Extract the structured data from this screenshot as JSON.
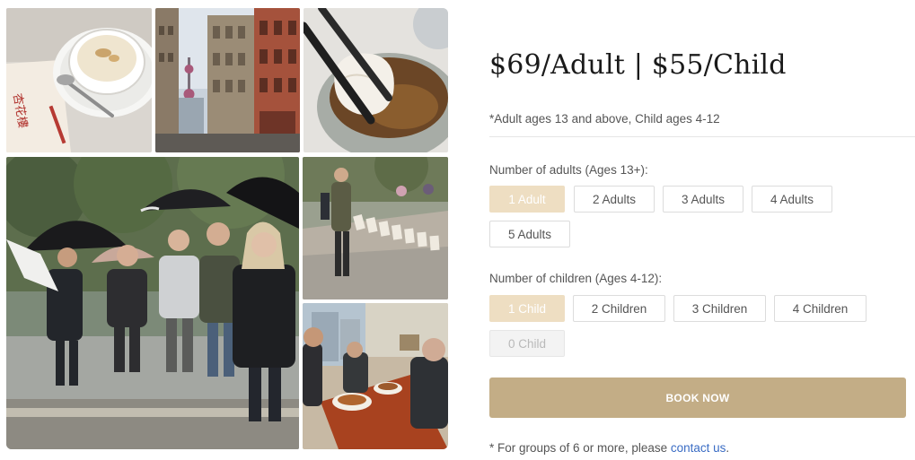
{
  "gallery": {
    "photos": [
      {
        "subject": "congee bowl with dim sum menu"
      },
      {
        "subject": "Bund street with Oriental Pearl Tower"
      },
      {
        "subject": "chopsticks lifting a dumpling"
      },
      {
        "subject": "tour group with umbrellas in garden"
      },
      {
        "subject": "street vendor with book stall"
      },
      {
        "subject": "tour group eating noodles"
      }
    ],
    "sign_text": "杏花樓"
  },
  "pricing": {
    "headline": "$69/Adult | $55/Child",
    "ages_note": "*Adult ages 13 and above, Child ages 4-12"
  },
  "adults": {
    "label": "Number of adults (Ages 13+):",
    "options": [
      "1 Adult",
      "2 Adults",
      "3 Adults",
      "4 Adults",
      "5 Adults"
    ],
    "selected": "1 Adult"
  },
  "children": {
    "label": "Number of children (Ages 4-12):",
    "options": [
      "1 Child",
      "2 Children",
      "3 Children",
      "4 Children",
      "0 Child"
    ],
    "selected": "1 Child",
    "disabled": "0 Child"
  },
  "book_button": {
    "label": "BOOK NOW"
  },
  "group_note": {
    "text": "* For groups of 6 or more, please ",
    "link": "contact us",
    "suffix": "."
  },
  "colors": {
    "selected_bg": "#eedec2",
    "button_bg": "#c3ad86",
    "link": "#3a6cc4"
  }
}
